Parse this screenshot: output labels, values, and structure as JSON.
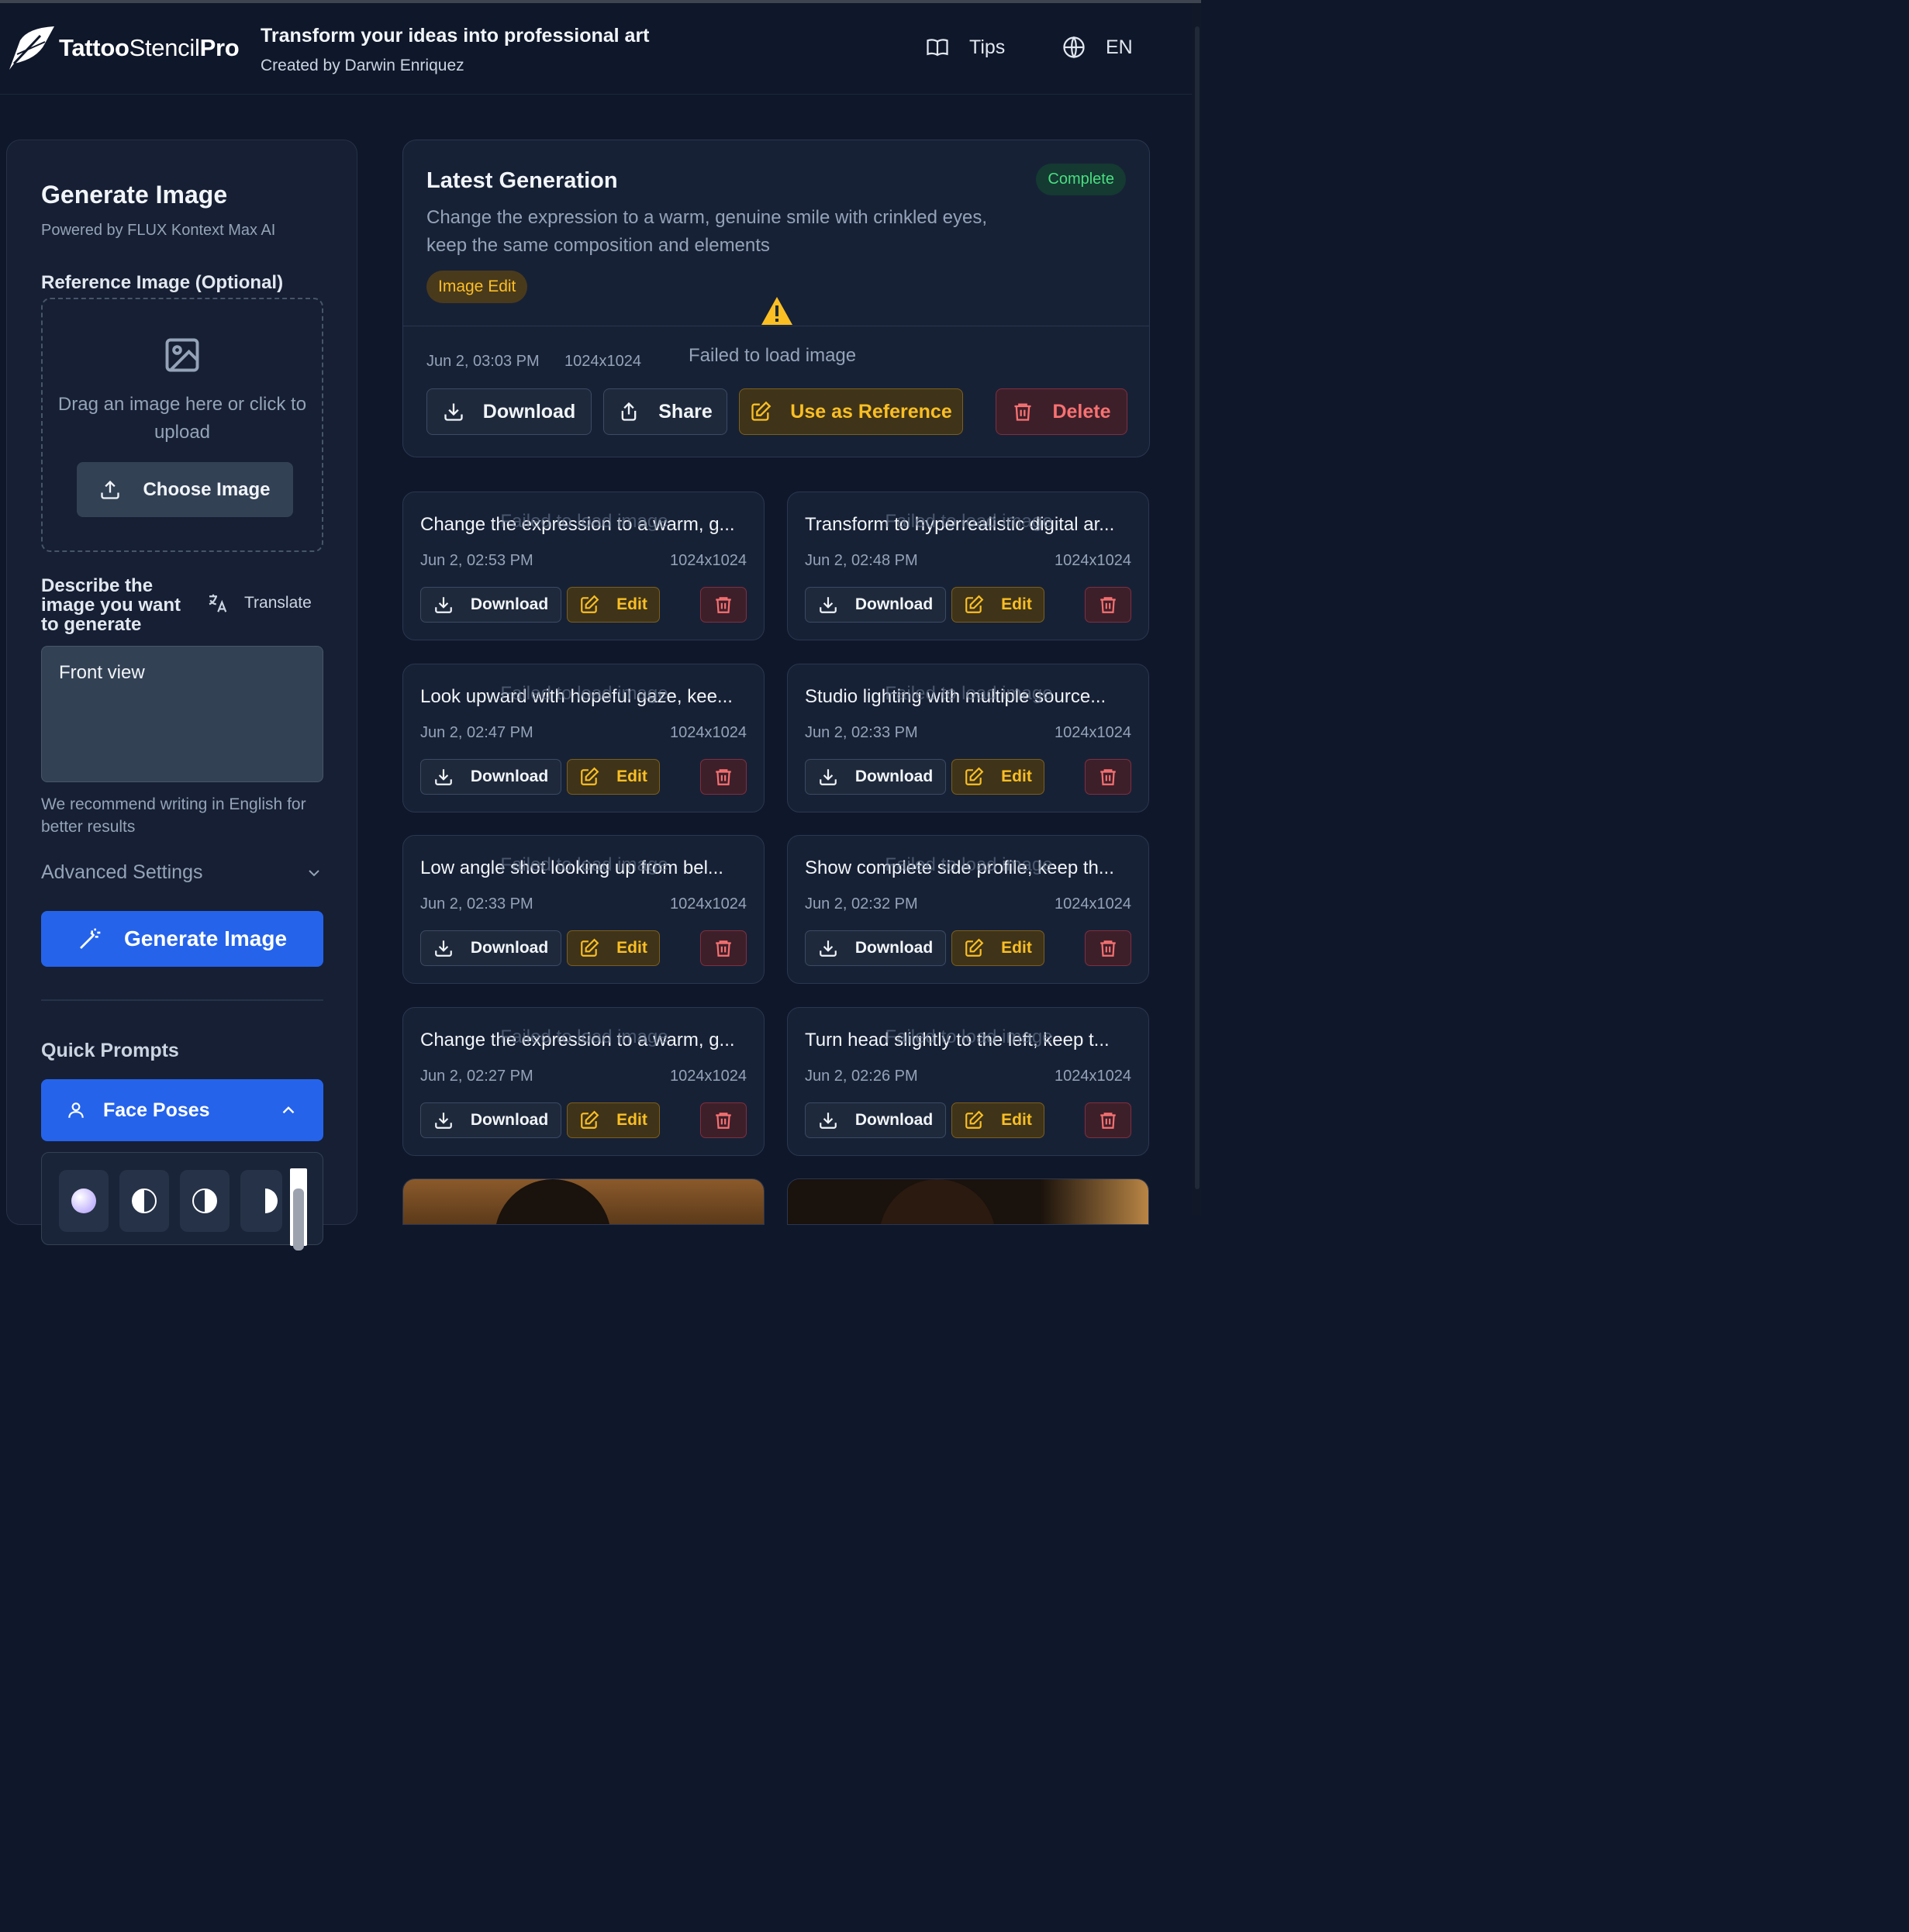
{
  "header": {
    "logo_text_bold1": "Tattoo",
    "logo_text_light": "Stencil",
    "logo_text_bold2": "Pro",
    "tagline": "Transform your ideas into professional art",
    "creator": "Created by Darwin Enriquez",
    "tips_label": "Tips",
    "language_label": "EN"
  },
  "generate": {
    "title": "Generate Image",
    "subtitle": "Powered by FLUX Kontext Max AI",
    "reference_label": "Reference Image (Optional)",
    "upload_text": "Drag an image here or click to upload",
    "choose_button": "Choose Image",
    "describe_label": "Describe the image you want to generate",
    "translate_label": "Translate",
    "prompt_value": "Front view",
    "recommendation": "We recommend writing in English for better results",
    "advanced_settings": "Advanced Settings",
    "generate_button": "Generate Image",
    "quick_prompts_label": "Quick Prompts",
    "face_poses_label": "Face Poses"
  },
  "latest": {
    "title": "Latest Generation",
    "status": "Complete",
    "description": "Change the expression to a warm, genuine smile with crinkled eyes, keep the same composition and elements",
    "type_badge": "Image Edit",
    "date": "Jun 2, 03:03 PM",
    "size": "1024x1024",
    "error": "Failed to load image",
    "download_label": "Download",
    "share_label": "Share",
    "reference_label": "Use as Reference",
    "delete_label": "Delete"
  },
  "history": [
    {
      "title": "Change the expression to a warm, g...",
      "date": "Jun 2, 02:53 PM",
      "size": "1024x1024",
      "error": "Failed to load image",
      "download": "Download",
      "edit": "Edit"
    },
    {
      "title": "Transform to hyperrealistic digital ar...",
      "date": "Jun 2, 02:48 PM",
      "size": "1024x1024",
      "error": "Failed to load image",
      "download": "Download",
      "edit": "Edit"
    },
    {
      "title": "Look upward with hopeful gaze, kee...",
      "date": "Jun 2, 02:47 PM",
      "size": "1024x1024",
      "error": "Failed to load image",
      "download": "Download",
      "edit": "Edit"
    },
    {
      "title": "Studio lighting with multiple source...",
      "date": "Jun 2, 02:33 PM",
      "size": "1024x1024",
      "error": "Failed to load image",
      "download": "Download",
      "edit": "Edit"
    },
    {
      "title": "Low angle shot looking up from bel...",
      "date": "Jun 2, 02:33 PM",
      "size": "1024x1024",
      "error": "Failed to load image",
      "download": "Download",
      "edit": "Edit"
    },
    {
      "title": "Show complete side profile, keep th...",
      "date": "Jun 2, 02:32 PM",
      "size": "1024x1024",
      "error": "Failed to load image",
      "download": "Download",
      "edit": "Edit"
    },
    {
      "title": "Change the expression to a warm, g...",
      "date": "Jun 2, 02:27 PM",
      "size": "1024x1024",
      "error": "Failed to load image",
      "download": "Download",
      "edit": "Edit"
    },
    {
      "title": "Turn head slightly to the left, keep t...",
      "date": "Jun 2, 02:26 PM",
      "size": "1024x1024",
      "error": "Failed to load image",
      "download": "Download",
      "edit": "Edit"
    }
  ],
  "colors": {
    "background": "#0f172a",
    "panel": "#172136",
    "accent_blue": "#2563eb",
    "amber": "#fbbf24",
    "red": "#f87171",
    "green": "#4ade80"
  }
}
